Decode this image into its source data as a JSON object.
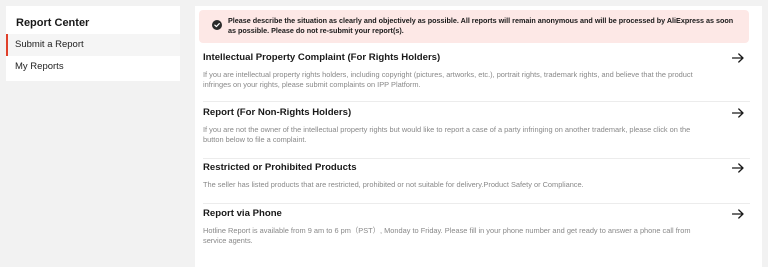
{
  "sidebar": {
    "title": "Report Center",
    "items": [
      {
        "label": "Submit a Report",
        "active": true
      },
      {
        "label": "My Reports",
        "active": false
      }
    ]
  },
  "notice": {
    "text": "Please describe the situation as clearly and objectively as possible. All reports will remain anonymous and will be processed by AliExpress as soon as possible. Please do not re-submit your report(s).",
    "icon": "check-circle-icon"
  },
  "report_types": [
    {
      "title": "Intellectual Property Complaint (For Rights Holders)",
      "description": "If you are intellectual property rights holders, including copyright (pictures, artworks, etc.), portrait rights, trademark rights, and believe that the product infringes on your rights, please submit complaints on IPP Platform."
    },
    {
      "title": "Report (For Non-Rights Holders)",
      "description": "If you are not the owner of the intellectual property rights but would like to report a case of a party infringing on another trademark, please click on the button below to file a complaint."
    },
    {
      "title": "Restricted or Prohibited Products",
      "description": "The seller has listed products that are restricted, prohibited or not suitable for delivery.Product Safety or Compliance."
    },
    {
      "title": "Report via Phone",
      "description": "Hotline Report is available from 9 am to 6 pm（PST）, Monday to Friday. Please fill in your phone number and get ready to answer a phone call from service agents."
    }
  ],
  "colors": {
    "accent": "#e0402a",
    "notice_bg": "#fde8e6",
    "page_bg": "#f2f2f2"
  }
}
